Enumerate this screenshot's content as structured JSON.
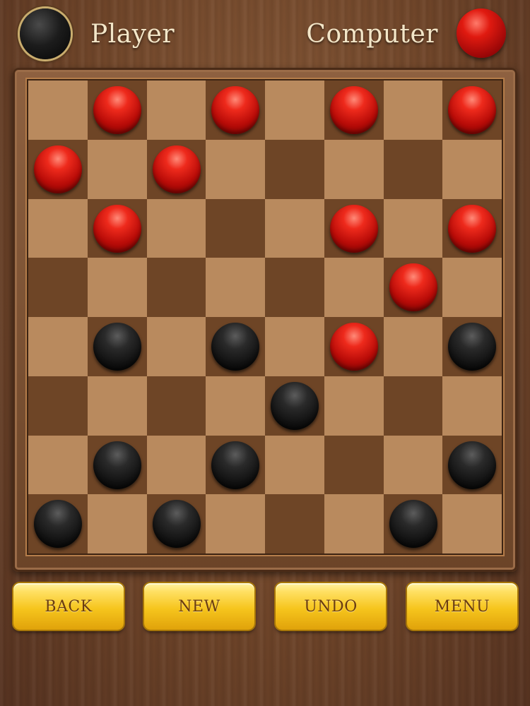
{
  "header": {
    "player_label": "Player",
    "computer_label": "Computer",
    "player_color": "black",
    "computer_color": "red"
  },
  "board": {
    "size": 8,
    "colors": {
      "light": "#b98a5e",
      "dark": "#6e4526"
    },
    "rows": [
      [
        "",
        "red",
        "",
        "red",
        "",
        "red",
        "",
        "red"
      ],
      [
        "red",
        "",
        "red",
        "",
        "",
        "",
        "",
        ""
      ],
      [
        "",
        "red",
        "",
        "",
        "",
        "red",
        "",
        "red"
      ],
      [
        "",
        "",
        "",
        "",
        "",
        "",
        "red",
        ""
      ],
      [
        "",
        "black",
        "",
        "black",
        "",
        "red",
        "",
        "black"
      ],
      [
        "",
        "",
        "",
        "",
        "black",
        "",
        "",
        ""
      ],
      [
        "",
        "black",
        "",
        "black",
        "",
        "",
        "",
        "black"
      ],
      [
        "black",
        "",
        "black",
        "",
        "",
        "",
        "black",
        ""
      ]
    ]
  },
  "controls": {
    "back_label": "BACK",
    "new_label": "NEW",
    "undo_label": "UNDO",
    "menu_label": "MENU"
  }
}
